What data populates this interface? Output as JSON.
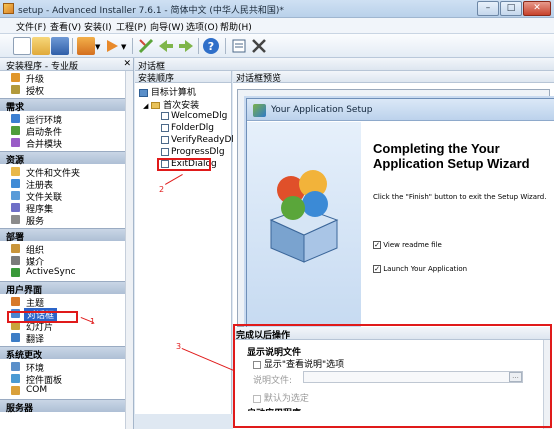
{
  "window": {
    "title": "setup - Advanced Installer 7.6.1 - 简体中文 (中华人民共和国)*",
    "controls": [
      "minimize",
      "maximize",
      "close"
    ]
  },
  "menu": [
    "文件(F)",
    "查看(V)",
    "安装(I)",
    "工程(P)",
    "向导(W)",
    "选项(O)",
    "帮助(H)"
  ],
  "toolbar_icons": [
    "new-icon",
    "open-icon",
    "save-icon",
    "build-icon",
    "run-icon",
    "add-icon",
    "back-icon",
    "forward-icon",
    "help-icon",
    "properties-icon",
    "delete-icon"
  ],
  "left_panel": {
    "header": "安装程序 - 专业版",
    "top_items": [
      {
        "label": "升级",
        "icon": "upgrade-icon",
        "color": "#e0962b"
      },
      {
        "label": "授权",
        "icon": "license-icon",
        "color": "#b39a3b"
      }
    ],
    "sections": [
      {
        "title": "需求",
        "items": [
          {
            "label": "运行环境",
            "icon": "runtime-icon",
            "color": "#3b7fd1"
          },
          {
            "label": "启动条件",
            "icon": "launch-icon",
            "color": "#4f9d3b"
          },
          {
            "label": "合并模块",
            "icon": "merge-icon",
            "color": "#9a5cc7"
          }
        ]
      },
      {
        "title": "资源",
        "items": [
          {
            "label": "文件和文件夹",
            "icon": "folder-icon",
            "color": "#e8b84a"
          },
          {
            "label": "注册表",
            "icon": "registry-icon",
            "color": "#3f8bd6"
          },
          {
            "label": "文件关联",
            "icon": "file-assoc-icon",
            "color": "#5a9bd8"
          },
          {
            "label": "程序集",
            "icon": "assembly-icon",
            "color": "#6f6fc7"
          },
          {
            "label": "服务",
            "icon": "service-icon",
            "color": "#8b8b8b"
          }
        ]
      },
      {
        "title": "部署",
        "items": [
          {
            "label": "组织",
            "icon": "organize-icon",
            "color": "#c9953a"
          },
          {
            "label": "媒介",
            "icon": "media-icon",
            "color": "#7b7b7b"
          },
          {
            "label": "ActiveSync",
            "icon": "activesync-icon",
            "color": "#3a9a3a"
          }
        ]
      },
      {
        "title": "用户界面",
        "items": [
          {
            "label": "主题",
            "icon": "theme-icon",
            "color": "#d77a2a"
          },
          {
            "label": "对话框",
            "icon": "dialog-icon",
            "color": "#4b86cf",
            "selected": true
          },
          {
            "label": "幻灯片",
            "icon": "slideshow-icon",
            "color": "#c9a43a"
          },
          {
            "label": "翻译",
            "icon": "translate-icon",
            "color": "#3d7dc6"
          }
        ]
      },
      {
        "title": "系统更改",
        "items": [
          {
            "label": "环境",
            "icon": "environment-icon",
            "color": "#5a8fc9"
          },
          {
            "label": "控件面板",
            "icon": "control-panel-icon",
            "color": "#4a9ad3"
          },
          {
            "label": "COM",
            "icon": "com-icon",
            "color": "#d9a03a"
          }
        ]
      },
      {
        "title": "服务器",
        "items": []
      }
    ]
  },
  "main": {
    "header": "对话框",
    "tree": {
      "header": "安装顺序",
      "root": "目标计算机",
      "group": "首次安装",
      "items": [
        "WelcomeDlg",
        "FolderDlg",
        "VerifyReadyDlg",
        "ProgressDlg",
        "ExitDialog"
      ],
      "selected": "ExitDialog"
    },
    "preview": {
      "header": "对话框预览",
      "dialog_title": "Your Application Setup",
      "heading": "Completing the Your Application Setup Wizard",
      "body": "Click the \"Finish\" button to exit the Setup Wizard.",
      "checkboxes": [
        {
          "label": "View readme file",
          "checked": true
        },
        {
          "label": "Launch Your Application",
          "checked": true
        }
      ]
    },
    "bottom": {
      "header": "完成以后操作",
      "group_label": "显示说明文件",
      "checkbox_show_readme": "显示\"查看说明\"选项",
      "field_label": "说明文件:",
      "field_value": "",
      "browse_label": "...",
      "checkbox_default": "默认为选定",
      "next_group_partial": "启动应用程序"
    }
  },
  "annotations": {
    "marker_1": "1",
    "marker_2": "2",
    "marker_3": "3"
  }
}
